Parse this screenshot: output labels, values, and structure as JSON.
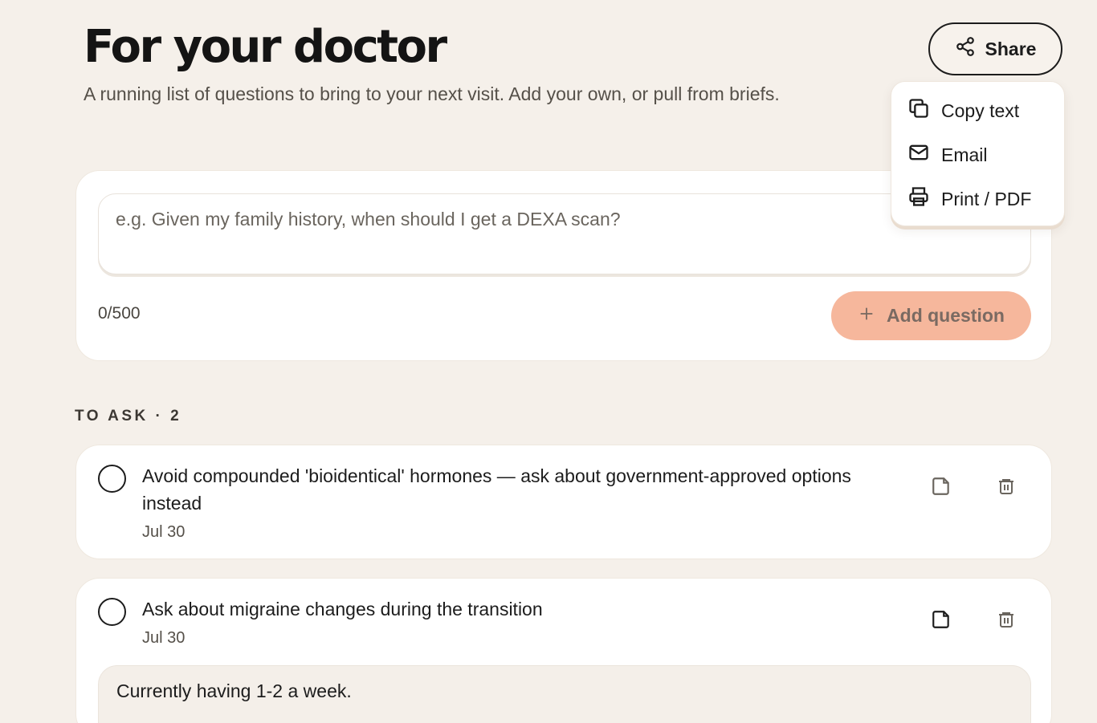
{
  "header": {
    "title": "For your doctor",
    "subtitle": "A running list of questions to bring to your next visit. Add your own, or pull from briefs."
  },
  "share": {
    "label": "Share",
    "icon": "share-icon",
    "menu": [
      {
        "label": "Copy text",
        "icon": "copy-icon"
      },
      {
        "label": "Email",
        "icon": "mail-icon"
      },
      {
        "label": "Print / PDF",
        "icon": "printer-icon"
      }
    ]
  },
  "composer": {
    "placeholder": "e.g. Given my family history, when should I get a DEXA scan?",
    "value": "",
    "char_count": "0/500",
    "add_label": "Add question",
    "add_icon": "plus-icon",
    "add_color": "#f6b79c"
  },
  "to_ask": {
    "heading": "TO ASK · 2",
    "items": [
      {
        "text": "Avoid compounded 'bioidentical' hormones — ask about government-approved options instead",
        "date": "Jul 30",
        "note": null
      },
      {
        "text": "Ask about migraine changes during the transition",
        "date": "Jul 30",
        "note": "Currently having 1-2 a week."
      }
    ]
  },
  "colors": {
    "background": "#f5f0ea",
    "card": "#ffffff",
    "accent": "#f6b79c",
    "text": "#1c1c1c"
  }
}
